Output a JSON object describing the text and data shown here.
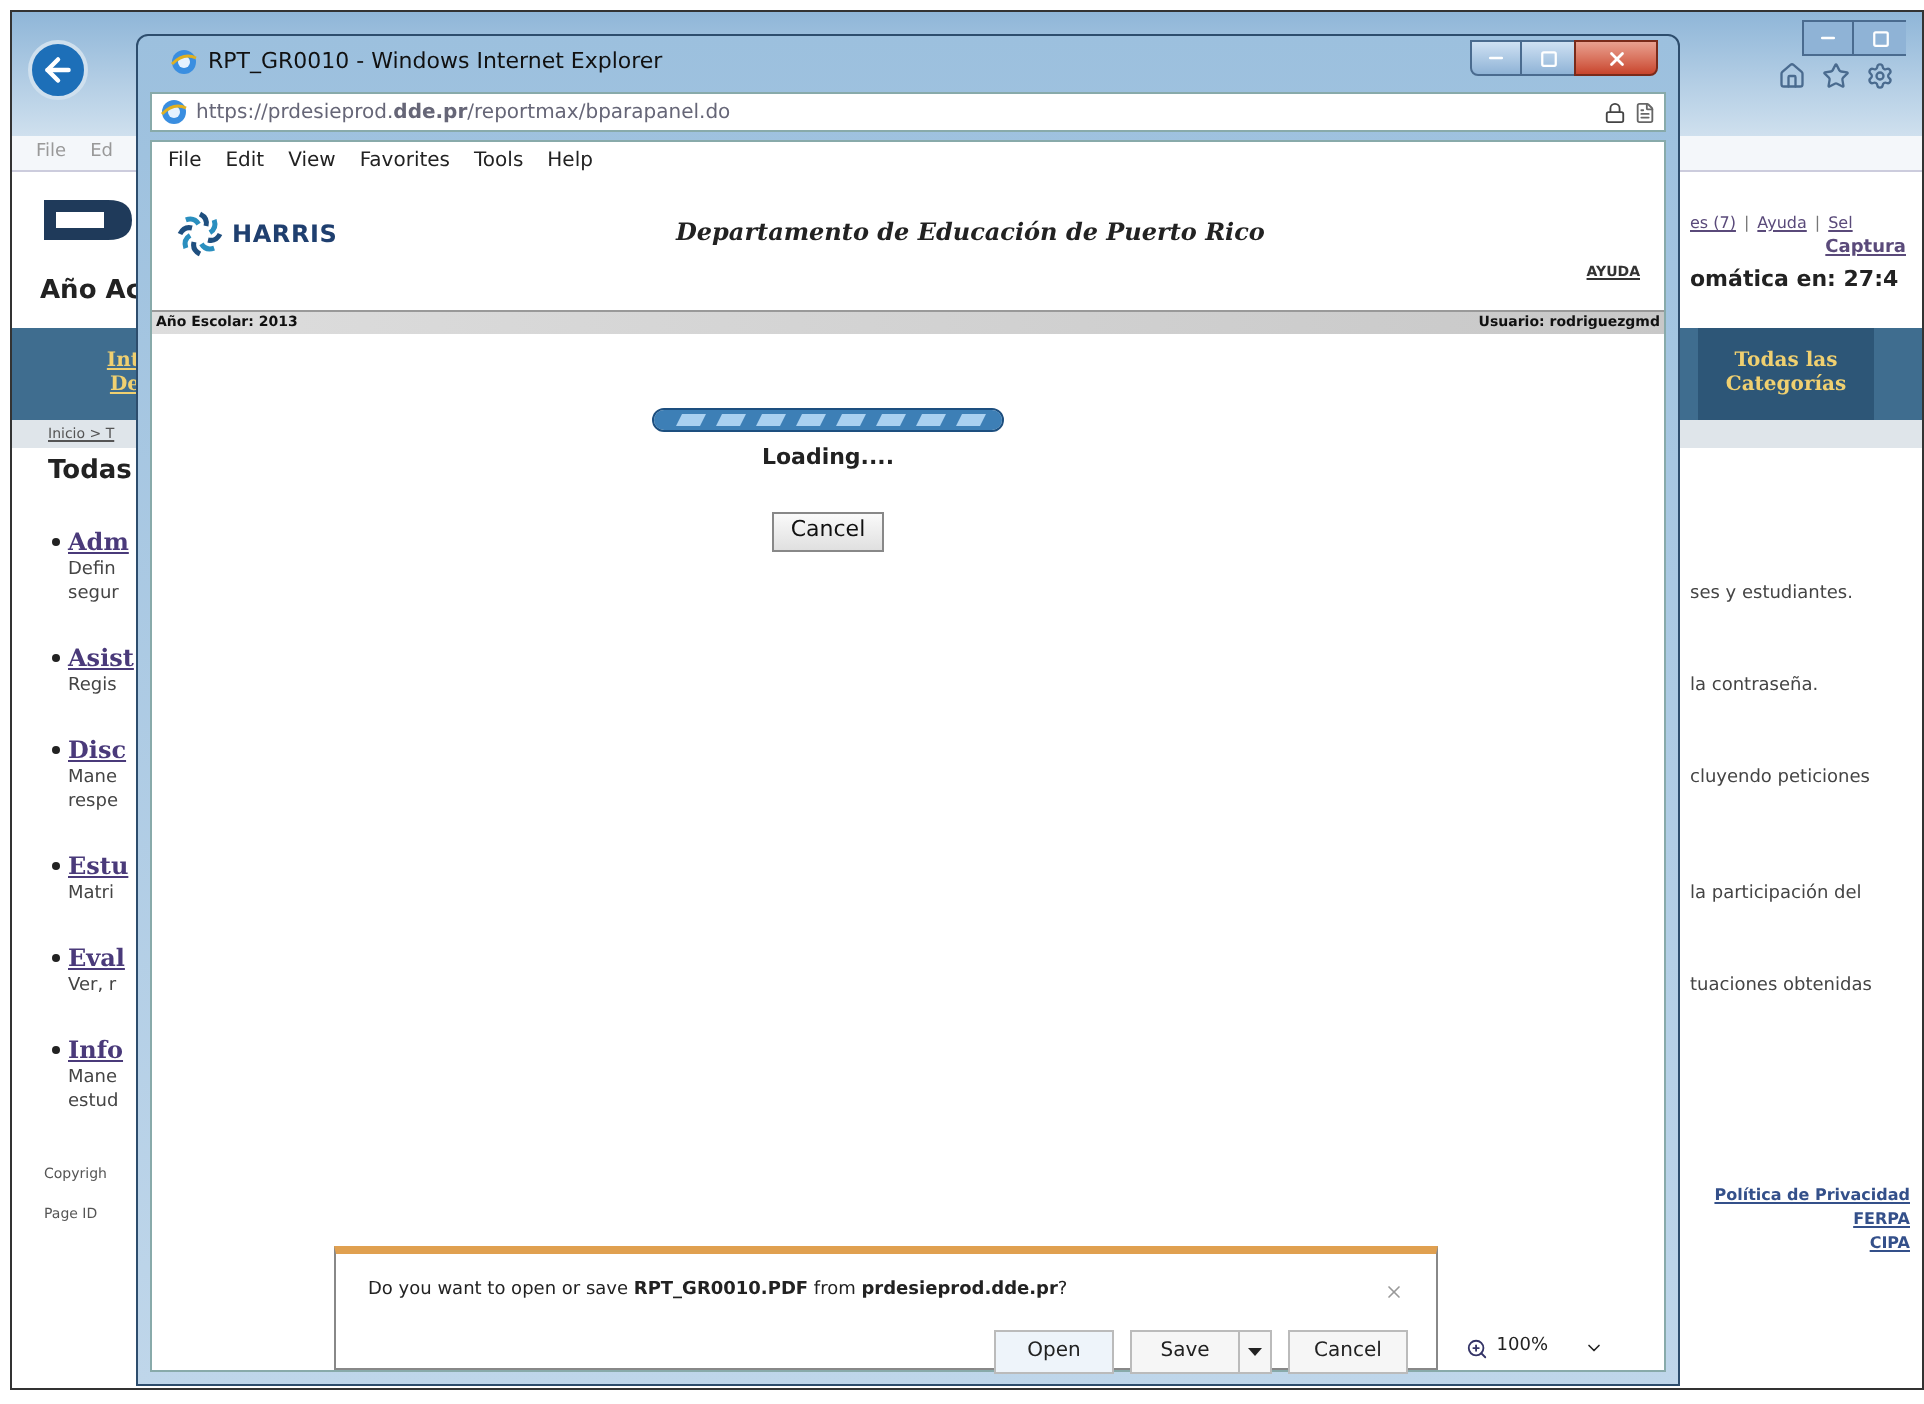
{
  "background_window": {
    "menu_partial": [
      "File",
      "Ed"
    ],
    "header": {
      "title_partial": "Año Ac",
      "links": [
        "es (7)",
        "Ayuda",
        "Sel"
      ],
      "link_separator": "|",
      "capture_link": "Captura",
      "timer_partial": "omática en: 27:4"
    },
    "nav": {
      "left_tab_lines": [
        "Int",
        "De"
      ],
      "right_tab": {
        "lines": [
          "Todas las",
          "Categorías"
        ],
        "selected": true
      }
    },
    "breadcrumb": "Inicio > T",
    "section_title": "Todas",
    "categories": [
      {
        "title": "Adm",
        "lines": [
          {
            "left": "Defin"
          },
          {
            "left": "segur",
            "right": "ses y estudiantes."
          }
        ]
      },
      {
        "title": "Asist",
        "lines": [
          {
            "left": "Regis",
            "right": "la contraseña."
          }
        ]
      },
      {
        "title": "Disc",
        "lines": [
          {
            "left": "Mane",
            "right": "cluyendo peticiones"
          },
          {
            "left": "respe"
          }
        ]
      },
      {
        "title": "Estu",
        "lines": [
          {
            "left": "Matri",
            "right": "la participación del"
          }
        ]
      },
      {
        "title": "Eval",
        "lines": [
          {
            "left": "Ver, r",
            "right": "tuaciones obtenidas"
          }
        ]
      },
      {
        "title": "Info",
        "lines": [
          {
            "left": "Mane"
          },
          {
            "left": "estud"
          }
        ]
      }
    ],
    "footer": {
      "left": [
        "Copyrigh",
        "Page ID"
      ],
      "right": [
        "Política de Privacidad",
        "FERPA",
        "CIPA"
      ]
    }
  },
  "popup_window": {
    "title": "RPT_GR0010 - Windows Internet Explorer",
    "address": "https://prdesieprod.**dde.pr**/reportmax/bparapanel.do",
    "menu": [
      "File",
      "Edit",
      "View",
      "Favorites",
      "Tools",
      "Help"
    ],
    "brand": "HARRIS",
    "page_title": "Departamento de Educación de Puerto Rico",
    "help_link": "AYUDA",
    "info_bar": {
      "left": "Año Escolar: 2013",
      "right": "Usuario: rodriguezgmd"
    },
    "progress": {
      "level": 1
    },
    "loading_text": "Loading....",
    "cancel_button": "Cancel",
    "download_bar": {
      "message": "Do you want to open or save **RPT_GR0010.PDF** from **prdesieprod.dde.pr**?",
      "buttons": [
        "Open",
        "Save",
        "Cancel"
      ]
    },
    "zoom": "100%"
  }
}
